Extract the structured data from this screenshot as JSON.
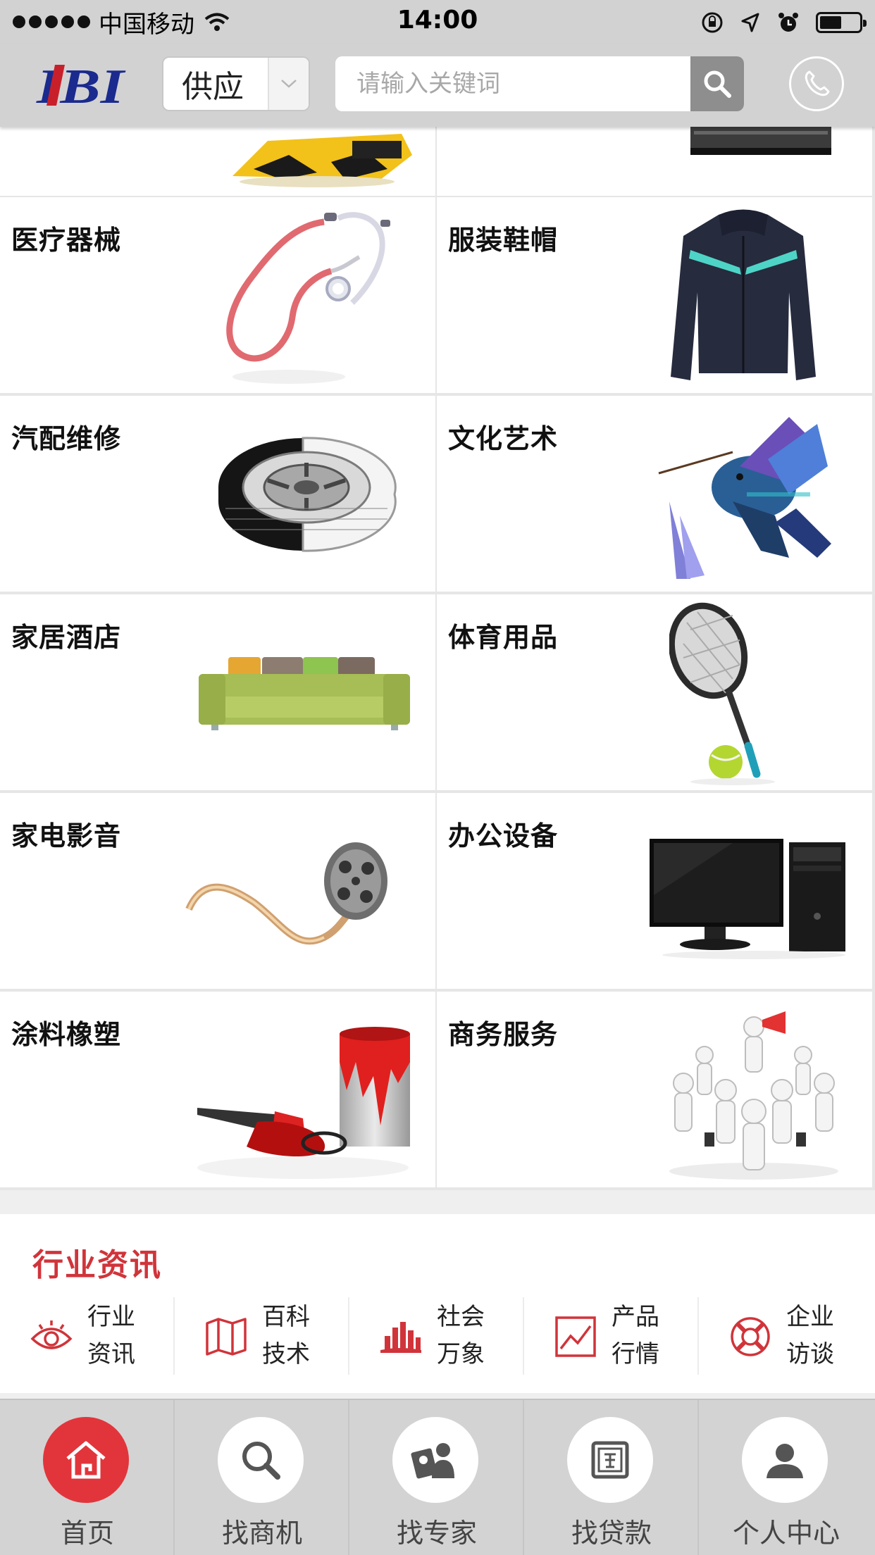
{
  "status_bar": {
    "carrier": "中国移动",
    "time": "14:00",
    "battery_level": 0.55
  },
  "header": {
    "logo_text": "IBI",
    "type_select_value": "供应",
    "search_placeholder": "请输入关键词"
  },
  "categories": [
    {
      "label": "",
      "picture": "yellow-machine"
    },
    {
      "label": "",
      "picture": "black-device"
    },
    {
      "label": "医疗器械",
      "picture": "stethoscope"
    },
    {
      "label": "服装鞋帽",
      "picture": "jacket"
    },
    {
      "label": "汽配维修",
      "picture": "tire"
    },
    {
      "label": "文化艺术",
      "picture": "hummingbird"
    },
    {
      "label": "家居酒店",
      "picture": "sofa"
    },
    {
      "label": "体育用品",
      "picture": "tennis-racket"
    },
    {
      "label": "家电影音",
      "picture": "film-reel"
    },
    {
      "label": "办公设备",
      "picture": "computer"
    },
    {
      "label": "涂料橡塑",
      "picture": "paint-bucket"
    },
    {
      "label": "商务服务",
      "picture": "business-people"
    }
  ],
  "news": {
    "title": "行业资讯",
    "items": [
      {
        "line1": "行业",
        "line2": "资讯",
        "icon": "eye-icon"
      },
      {
        "line1": "百科",
        "line2": "技术",
        "icon": "map-icon"
      },
      {
        "line1": "社会",
        "line2": "万象",
        "icon": "city-icon"
      },
      {
        "line1": "产品",
        "line2": "行情",
        "icon": "trend-chart-icon"
      },
      {
        "line1": "企业",
        "line2": "访谈",
        "icon": "lifebuoy-icon"
      }
    ]
  },
  "tabbar": {
    "items": [
      {
        "label": "首页",
        "icon": "home-icon",
        "active": true
      },
      {
        "label": "找商机",
        "icon": "search-icon",
        "active": false
      },
      {
        "label": "找专家",
        "icon": "expert-icon",
        "active": false
      },
      {
        "label": "找贷款",
        "icon": "safe-icon",
        "active": false
      },
      {
        "label": "个人中心",
        "icon": "user-icon",
        "active": false
      }
    ]
  },
  "colors": {
    "accent_red": "#e2353b",
    "news_title_red": "#d0343a",
    "header_gray": "#d2d2d2"
  }
}
